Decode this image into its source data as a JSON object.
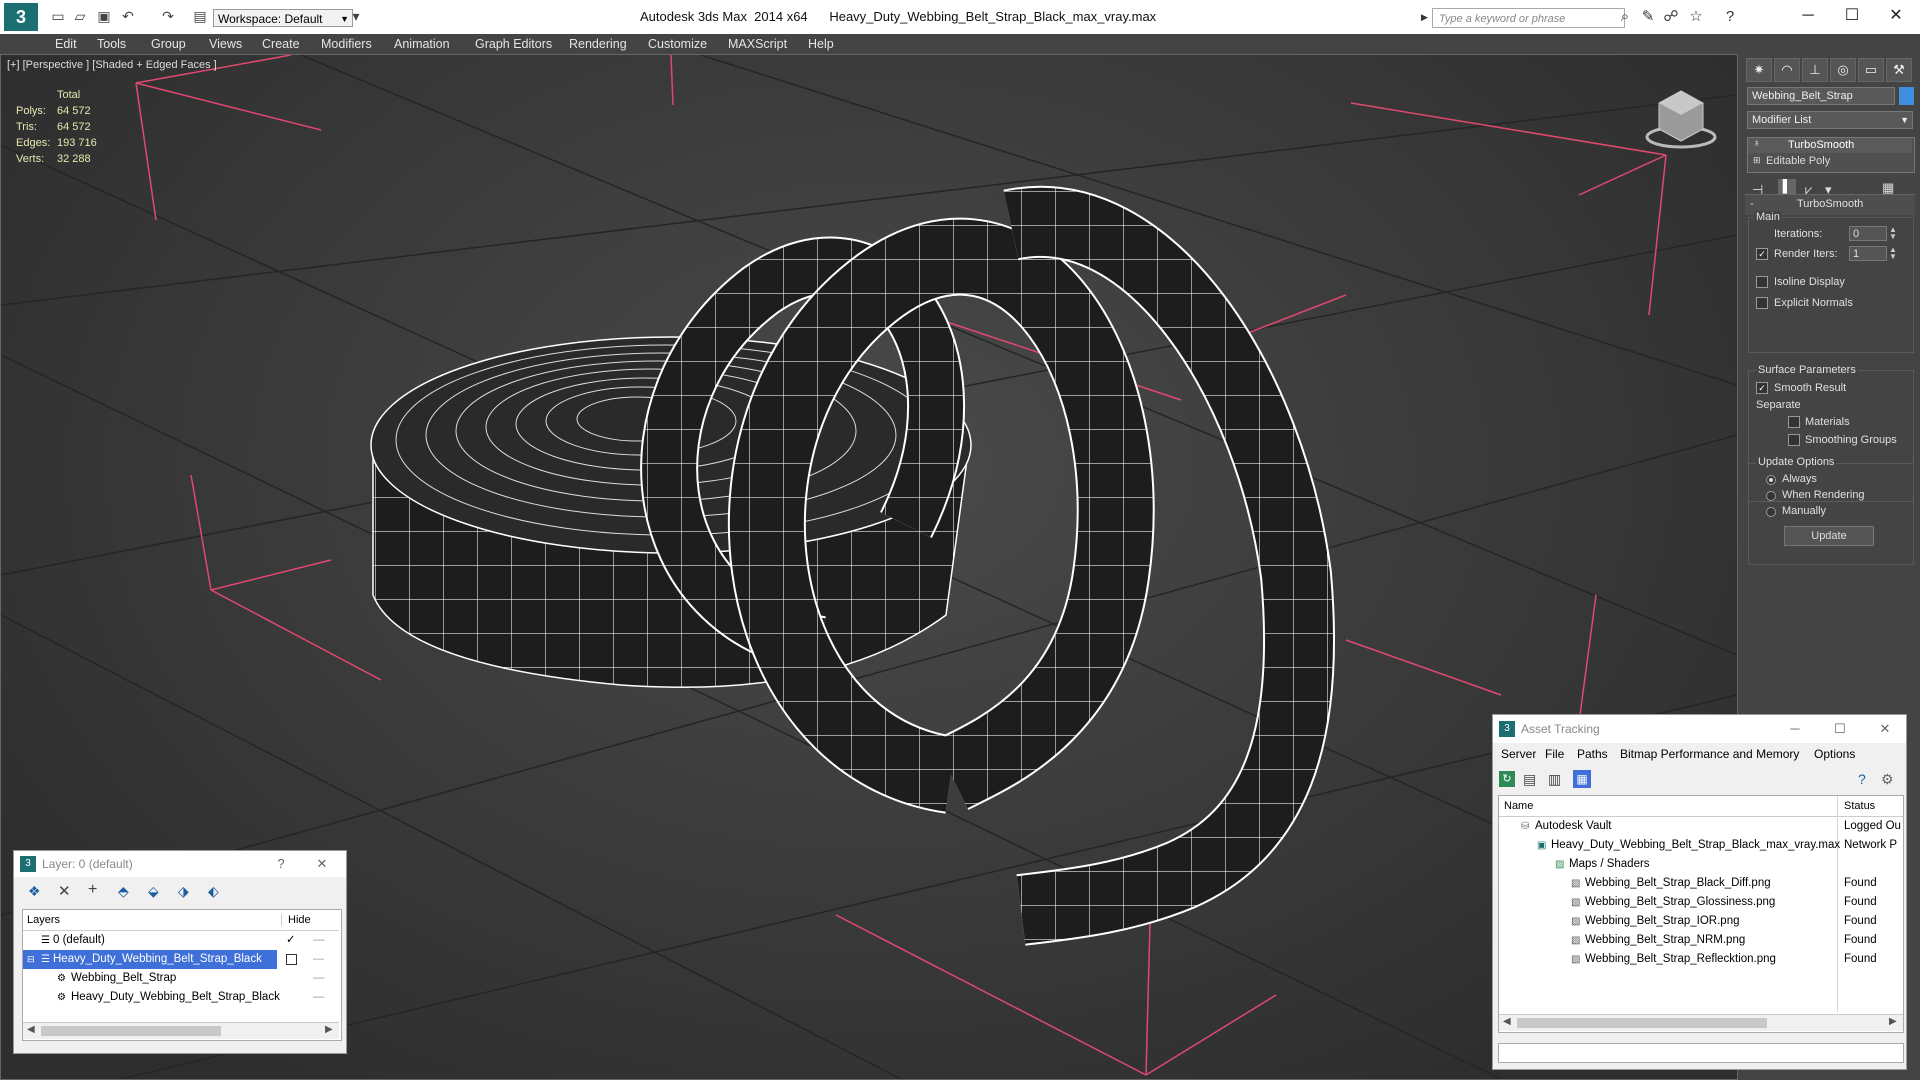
{
  "app": {
    "logo": "3",
    "title": "Autodesk 3ds Max  2014 x64      Heavy_Duty_Webbing_Belt_Strap_Black_max_vray.max",
    "workspace": "Workspace: Default",
    "search_placeholder": "Type a keyword or phrase"
  },
  "menu": [
    "Edit",
    "Tools",
    "Group",
    "Views",
    "Create",
    "Modifiers",
    "Animation",
    "Graph Editors",
    "Rendering",
    "Customize",
    "MAXScript",
    "Help"
  ],
  "viewport": {
    "label": "[+] [Perspective ] [Shaded + Edged Faces ]",
    "stats": {
      "header": "Total",
      "rows": [
        {
          "label": "Polys:",
          "value": "64 572"
        },
        {
          "label": "Tris:",
          "value": "64 572"
        },
        {
          "label": "Edges:",
          "value": "193 716"
        },
        {
          "label": "Verts:",
          "value": "32 288"
        }
      ]
    }
  },
  "command_panel": {
    "object_name": "Webbing_Belt_Strap",
    "modifier_list": "Modifier List",
    "stack": [
      "TurboSmooth",
      "Editable Poly"
    ],
    "rollout_title": "TurboSmooth",
    "main": "Main",
    "iterations_label": "Iterations:",
    "iterations": "0",
    "render_iters_label": "Render Iters:",
    "render_iters": "1",
    "isoline": "Isoline Display",
    "explicit_normals": "Explicit Normals",
    "surface_params": "Surface Parameters",
    "smooth_result": "Smooth Result",
    "separate": "Separate",
    "materials": "Materials",
    "smoothing_groups": "Smoothing Groups",
    "update_options": "Update Options",
    "always": "Always",
    "when_rendering": "When Rendering",
    "manually": "Manually",
    "update_button": "Update"
  },
  "layer_window": {
    "title": "Layer: 0 (default)",
    "help": "?",
    "col_layers": "Layers",
    "col_hide": "Hide",
    "rows": [
      {
        "name": "0 (default)",
        "indent": 0
      },
      {
        "name": "Heavy_Duty_Webbing_Belt_Strap_Black",
        "indent": 0
      },
      {
        "name": "Webbing_Belt_Strap",
        "indent": 1
      },
      {
        "name": "Heavy_Duty_Webbing_Belt_Strap_Black",
        "indent": 1
      }
    ]
  },
  "asset_window": {
    "title": "Asset Tracking",
    "menu": [
      "Server",
      "File",
      "Paths",
      "Bitmap Performance and Memory",
      "Options"
    ],
    "col_name": "Name",
    "col_status": "Status",
    "rows": [
      {
        "name": "Autodesk Vault",
        "status": "Logged Ou"
      },
      {
        "name": "Heavy_Duty_Webbing_Belt_Strap_Black_max_vray.max",
        "status": "Network P"
      },
      {
        "name": "Maps / Shaders",
        "status": ""
      },
      {
        "name": "Webbing_Belt_Strap_Black_Diff.png",
        "status": "Found"
      },
      {
        "name": "Webbing_Belt_Strap_Glossiness.png",
        "status": "Found"
      },
      {
        "name": "Webbing_Belt_Strap_IOR.png",
        "status": "Found"
      },
      {
        "name": "Webbing_Belt_Strap_NRM.png",
        "status": "Found"
      },
      {
        "name": "Webbing_Belt_Strap_Reflecktion.png",
        "status": "Found"
      }
    ]
  },
  "colors": {
    "accent": "#1b6e72",
    "selection": "#3f6fd8",
    "grid": "#e04870"
  }
}
